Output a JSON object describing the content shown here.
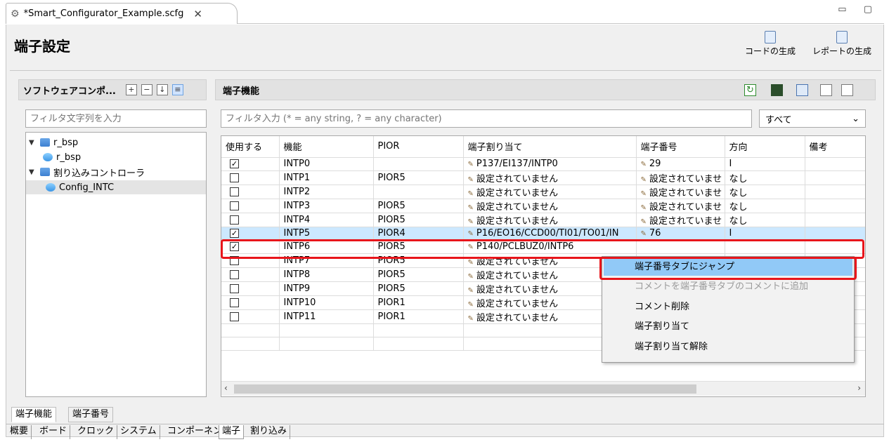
{
  "editor": {
    "tab_title": "*Smart_Configurator_Example.scfg",
    "close_glyph": "✕",
    "window_buttons": "▭ ▢"
  },
  "page": {
    "title": "端子設定"
  },
  "header_buttons": {
    "generate_code": "コードの生成",
    "generate_report": "レポートの生成"
  },
  "left_panel": {
    "title": "ソフトウェアコンポ...",
    "filter_placeholder": "フィルタ文字列を入力",
    "tree": [
      {
        "label": "r_bsp",
        "expanded": true,
        "level": 0
      },
      {
        "label": "r_bsp",
        "level": 1
      },
      {
        "label": "割り込みコントローラ",
        "expanded": true,
        "level": 0
      },
      {
        "label": "Config_INTC",
        "level": 1,
        "selected": true
      }
    ]
  },
  "right_panel": {
    "title": "端子機能",
    "filter_placeholder": "フィルタ入力 (* = any string, ? = any character)",
    "scope": "すべて"
  },
  "table": {
    "columns": [
      "使用する",
      "機能",
      "PIOR",
      "端子割り当て",
      "端子番号",
      "方向",
      "備考"
    ],
    "rows": [
      {
        "use": true,
        "function": "INTP0",
        "pior": "",
        "pin_assign": "P137/EI137/INTP0",
        "pin_no": "29",
        "direction": "I",
        "note": ""
      },
      {
        "use": false,
        "function": "INTP1",
        "pior": "PIOR5",
        "pin_assign": "設定されていません",
        "pin_no": "設定されていませ",
        "direction": "なし",
        "note": ""
      },
      {
        "use": false,
        "function": "INTP2",
        "pior": "",
        "pin_assign": "設定されていません",
        "pin_no": "設定されていませ",
        "direction": "なし",
        "note": ""
      },
      {
        "use": false,
        "function": "INTP3",
        "pior": "PIOR5",
        "pin_assign": "設定されていません",
        "pin_no": "設定されていませ",
        "direction": "なし",
        "note": ""
      },
      {
        "use": false,
        "function": "INTP4",
        "pior": "PIOR5",
        "pin_assign": "設定されていません",
        "pin_no": "設定されていませ",
        "direction": "なし",
        "note": ""
      },
      {
        "use": true,
        "function": "INTP5",
        "pior": "PIOR4",
        "pin_assign": "P16/EO16/CCD00/TI01/TO01/IN",
        "pin_no": "76",
        "direction": "I",
        "note": "",
        "selected": true
      },
      {
        "use": true,
        "function": "INTP6",
        "pior": "PIOR5",
        "pin_assign": "P140/PCLBUZ0/INTP6",
        "pin_no": "",
        "direction": "",
        "note": ""
      },
      {
        "use": false,
        "function": "INTP7",
        "pior": "PIOR5",
        "pin_assign": "設定されていません",
        "pin_no": "",
        "direction": "",
        "note": ""
      },
      {
        "use": false,
        "function": "INTP8",
        "pior": "PIOR5",
        "pin_assign": "設定されていません",
        "pin_no": "",
        "direction": "",
        "note": ""
      },
      {
        "use": false,
        "function": "INTP9",
        "pior": "PIOR5",
        "pin_assign": "設定されていません",
        "pin_no": "",
        "direction": "",
        "note": ""
      },
      {
        "use": false,
        "function": "INTP10",
        "pior": "PIOR1",
        "pin_assign": "設定されていません",
        "pin_no": "",
        "direction": "",
        "note": ""
      },
      {
        "use": false,
        "function": "INTP11",
        "pior": "PIOR1",
        "pin_assign": "設定されていません",
        "pin_no": "",
        "direction": "",
        "note": ""
      }
    ]
  },
  "context_menu": {
    "items": [
      {
        "label": "端子番号タブにジャンプ",
        "state": "hover"
      },
      {
        "label": "コメントを端子番号タブのコメントに追加",
        "state": "disabled"
      },
      {
        "label": "コメント削除",
        "state": "normal"
      },
      {
        "label": "端子割り当て",
        "state": "normal"
      },
      {
        "label": "端子割り当て解除",
        "state": "normal"
      }
    ]
  },
  "bottom_tabs": {
    "pin_function": "端子機能",
    "pin_number": "端子番号"
  },
  "nav_tabs": [
    "概要",
    "ボード",
    "クロック",
    "システム",
    "コンポーネント",
    "端子",
    "割り込み"
  ],
  "nav_active": "端子",
  "colors": {
    "highlight": "#e8151b",
    "row_selected": "#cce8ff",
    "menu_hover": "#91c9f7"
  }
}
